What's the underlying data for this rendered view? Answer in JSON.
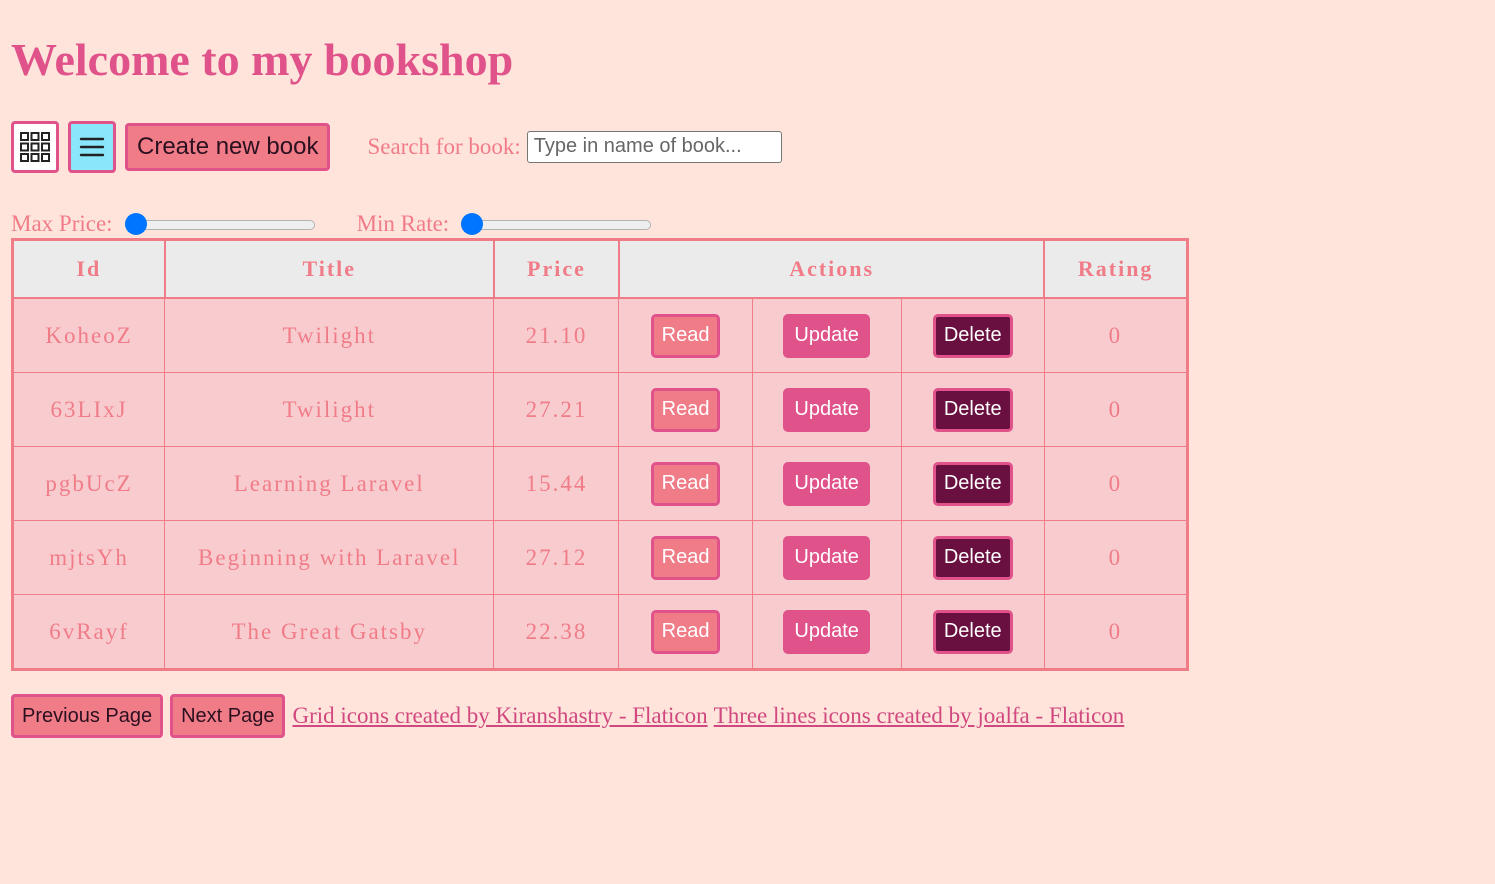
{
  "page": {
    "title": "Welcome to my bookshop"
  },
  "toolbar": {
    "grid_icon": "grid-icon",
    "list_icon": "three-lines-icon",
    "create_label": "Create new book",
    "search_label": "Search for book:",
    "search_placeholder": "Type in name of book...",
    "search_value": ""
  },
  "filters": {
    "max_price_label": "Max Price:",
    "max_price_value": 0,
    "min_rate_label": "Min Rate:",
    "min_rate_value": 0
  },
  "table": {
    "headers": {
      "id": "Id",
      "title": "Title",
      "price": "Price",
      "actions": "Actions",
      "rating": "Rating"
    },
    "action_labels": {
      "read": "Read",
      "update": "Update",
      "delete": "Delete"
    },
    "rows": [
      {
        "id": "KoheoZ",
        "title": "Twilight",
        "price": "21.10",
        "rating": "0"
      },
      {
        "id": "63LIxJ",
        "title": "Twilight",
        "price": "27.21",
        "rating": "0"
      },
      {
        "id": "pgbUcZ",
        "title": "Learning Laravel",
        "price": "15.44",
        "rating": "0"
      },
      {
        "id": "mjtsYh",
        "title": "Beginning with Laravel",
        "price": "27.12",
        "rating": "0"
      },
      {
        "id": "6vRayf",
        "title": "The Great Gatsby",
        "price": "22.38",
        "rating": "0"
      }
    ]
  },
  "footer": {
    "prev_label": "Previous Page",
    "next_label": "Next Page",
    "credit_grid": "Grid icons created by Kiranshastry - Flaticon",
    "credit_lines": "Three lines icons created by joalfa - Flaticon"
  },
  "colors": {
    "background": "#ffe4db",
    "accent": "#e0528a",
    "salmon": "#f07c88",
    "delete": "#6a1040",
    "list_toggle": "#8ae6fb"
  }
}
